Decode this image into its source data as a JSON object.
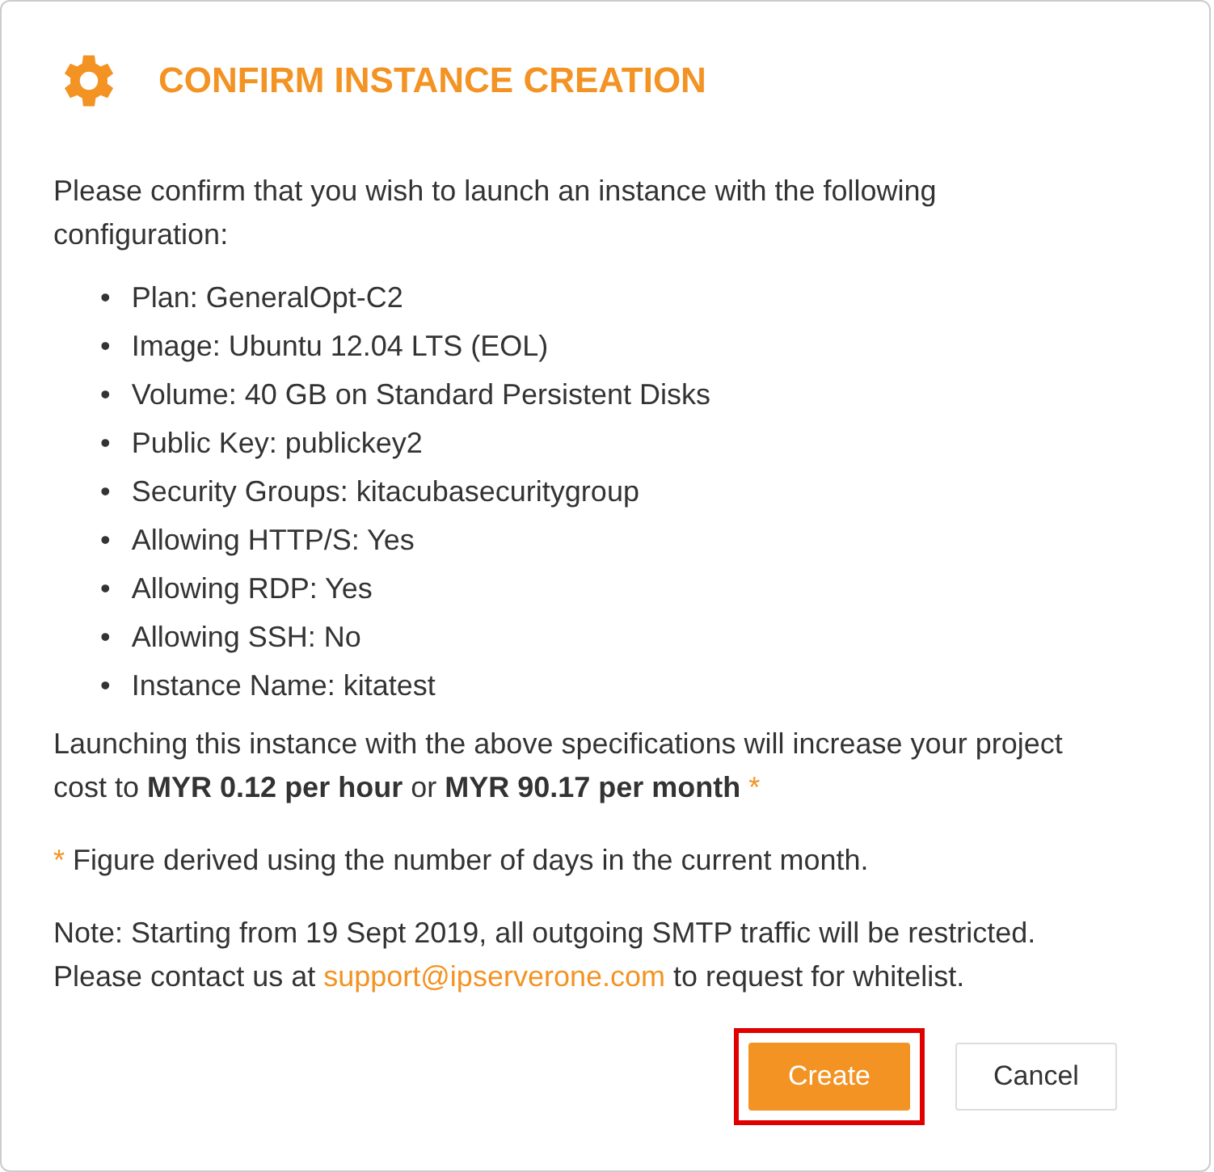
{
  "dialog": {
    "title": "CONFIRM INSTANCE CREATION",
    "intro": "Please confirm that you wish to launch an instance with the following configuration:",
    "bullet": "•",
    "items": [
      "Plan: GeneralOpt-C2",
      "Image: Ubuntu 12.04 LTS (EOL)",
      "Volume: 40 GB on Standard Persistent Disks",
      "Public Key: publickey2",
      "Security Groups: kitacubasecuritygroup",
      "Allowing HTTP/S: Yes",
      "Allowing RDP: Yes",
      "Allowing SSH: No",
      "Instance Name: kitatest"
    ],
    "cost": {
      "text": "Launching this instance with the above specifications will increase your project cost to **MYR 0.12 per hour** or **MYR 90.17 per month**",
      "mark": "*"
    },
    "footnote": {
      "mark": "*",
      "text": "Figure derived using the number of days in the current month."
    },
    "note": {
      "text": "Note: Starting from 19 Sept 2019, all outgoing SMTP traffic will be restricted.",
      "contact_prefix": "Please contact us at",
      "email": "support@ipserverone.com",
      "contact_suffix": "to request for whitelist."
    },
    "buttons": [
      {
        "label": "Create",
        "kind": "primary",
        "highlighted": true
      },
      {
        "label": "Cancel",
        "kind": "secondary"
      }
    ]
  }
}
